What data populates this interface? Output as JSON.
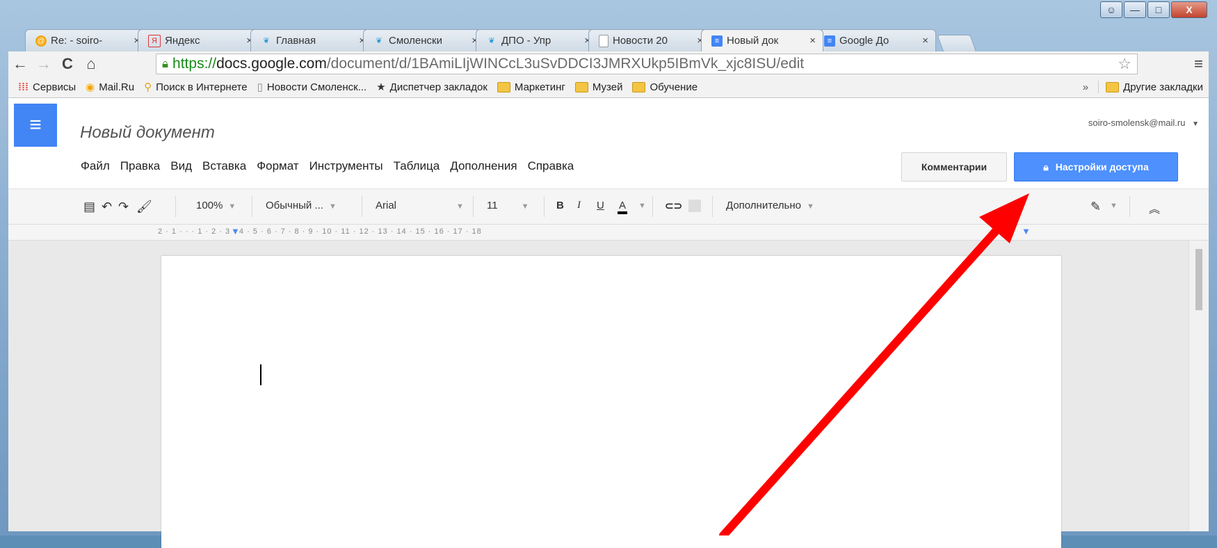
{
  "window": {
    "controls": {
      "minimize": "—",
      "maximize": "□",
      "close": "X",
      "user": "☺"
    }
  },
  "tabs": [
    {
      "label": "Re: - soiro-",
      "icon": "mail-ru-icon",
      "active": false
    },
    {
      "label": "Яндекс",
      "icon": "yandex-icon",
      "active": false
    },
    {
      "label": "Главная",
      "icon": "site-icon",
      "active": false
    },
    {
      "label": "Смоленски",
      "icon": "site-icon",
      "active": false
    },
    {
      "label": "ДПО - Упр",
      "icon": "site-icon",
      "active": false
    },
    {
      "label": "Новости 20",
      "icon": "page-icon",
      "active": false
    },
    {
      "label": "Новый док",
      "icon": "docs-icon",
      "active": true
    },
    {
      "label": "Google До",
      "icon": "docs-icon",
      "active": false
    }
  ],
  "browser": {
    "url_scheme": "https://",
    "url_host": "docs.google.com",
    "url_path": "/document/d/1BAmiLIjWINCcL3uSvDDCI3JMRXUkp5IBmVk_xjc8ISU/edit"
  },
  "bookmarks": [
    {
      "label": "Сервисы",
      "icon": "apps-icon"
    },
    {
      "label": "Mail.Ru",
      "icon": "mail-ru-icon"
    },
    {
      "label": "Поиск в Интернете",
      "icon": "search-icon"
    },
    {
      "label": "Новости Смоленск...",
      "icon": "page-icon"
    },
    {
      "label": "Диспетчер закладок",
      "icon": "star-icon"
    },
    {
      "label": "Маркетинг",
      "icon": "folder-icon"
    },
    {
      "label": "Музей",
      "icon": "folder-icon"
    },
    {
      "label": "Обучение",
      "icon": "folder-icon"
    }
  ],
  "bookmarks_more": "»",
  "bookmarks_other": "Другие закладки",
  "docs": {
    "title": "Новый документ",
    "account": "soiro-smolensk@mail.ru",
    "menus": [
      "Файл",
      "Правка",
      "Вид",
      "Вставка",
      "Формат",
      "Инструменты",
      "Таблица",
      "Дополнения",
      "Справка"
    ],
    "comments_label": "Комментарии",
    "share_label": "Настройки доступа"
  },
  "format_toolbar": {
    "zoom": "100%",
    "style": "Обычный ...",
    "font": "Arial",
    "size": "11",
    "bold": "B",
    "italic": "I",
    "underline": "U",
    "text_color": "A",
    "more": "Дополнительно"
  },
  "ruler": "2 · 1 · · · 1 · 2 · 3 · 4 · 5 · 6 · 7 · 8 · 9 · 10 · 11 · 12 · 13 · 14 · 15 · 16 · 17 · 18",
  "colors": {
    "share_blue": "#4d90fe",
    "docs_blue": "#4285f4",
    "arrow_red": "#ff0000"
  }
}
